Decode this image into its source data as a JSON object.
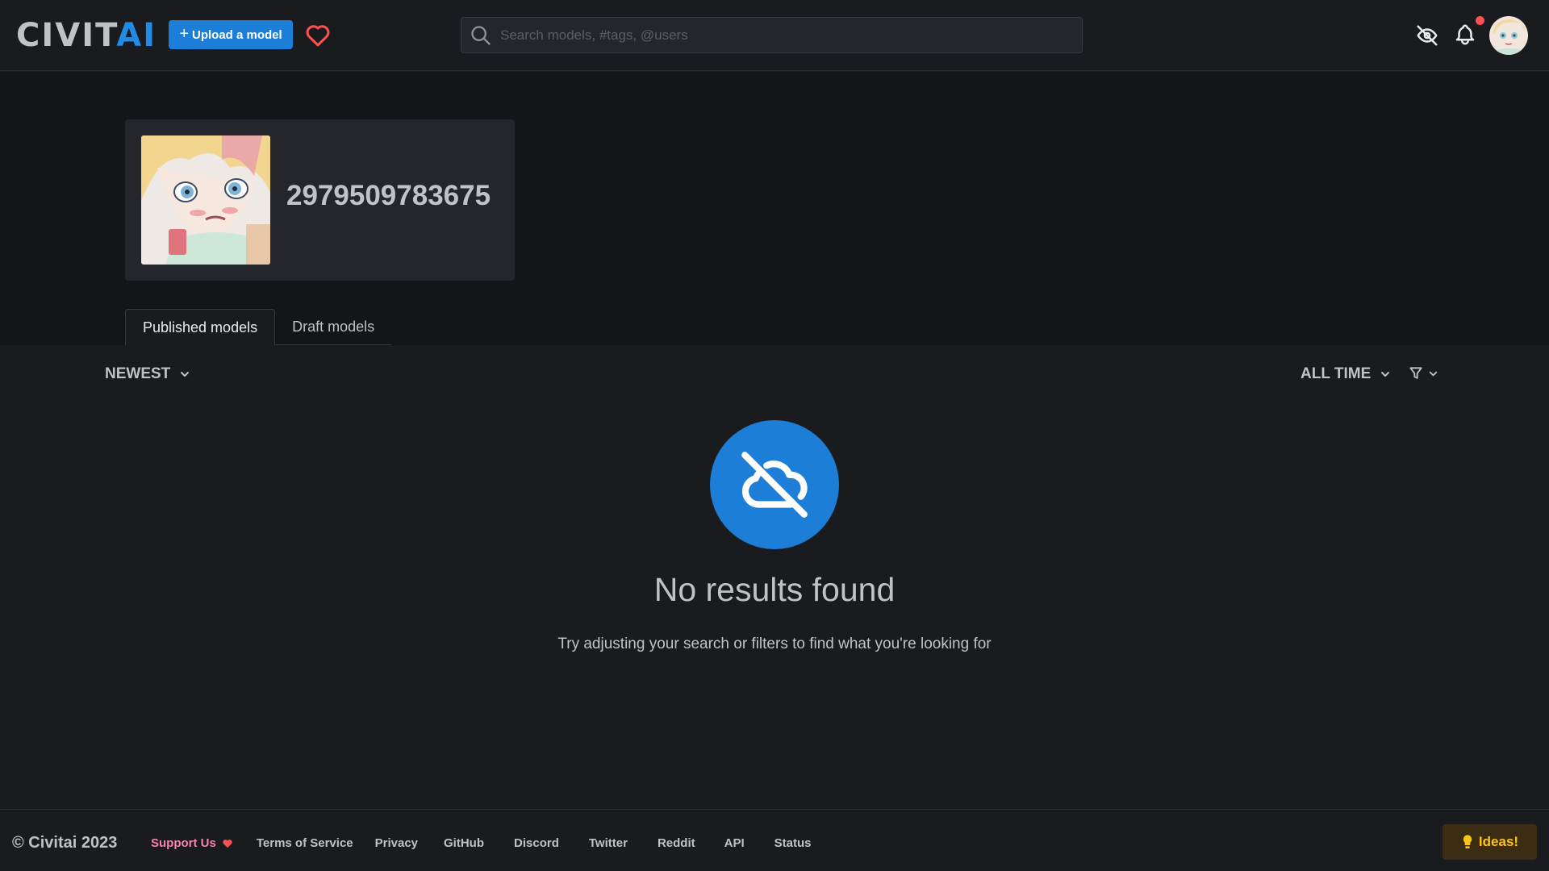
{
  "header": {
    "logo_main": "CIVIT",
    "logo_accent": "AI",
    "upload_label": "Upload a model",
    "search_placeholder": "Search models, #tags, @users"
  },
  "profile": {
    "username": "2979509783675",
    "tabs": [
      {
        "label": "Published models",
        "active": true
      },
      {
        "label": "Draft models",
        "active": false
      }
    ]
  },
  "filters": {
    "sort": "NEWEST",
    "period": "ALL TIME"
  },
  "empty_state": {
    "icon": "cloud-off-icon",
    "title": "No results found",
    "message": "Try adjusting your search or filters to find what you're looking for"
  },
  "footer": {
    "copyright": "© Civitai 2023",
    "support": "Support Us",
    "links": [
      "Terms of Service",
      "Privacy",
      "GitHub",
      "Discord",
      "Twitter",
      "Reddit",
      "API",
      "Status"
    ],
    "ideas_label": "Ideas!"
  },
  "colors": {
    "accent": "#1c7ed6",
    "background": "#1a1b1e",
    "band": "#141517",
    "card": "#25262b",
    "support": "#f783ac",
    "ideas": "#fcc419"
  }
}
